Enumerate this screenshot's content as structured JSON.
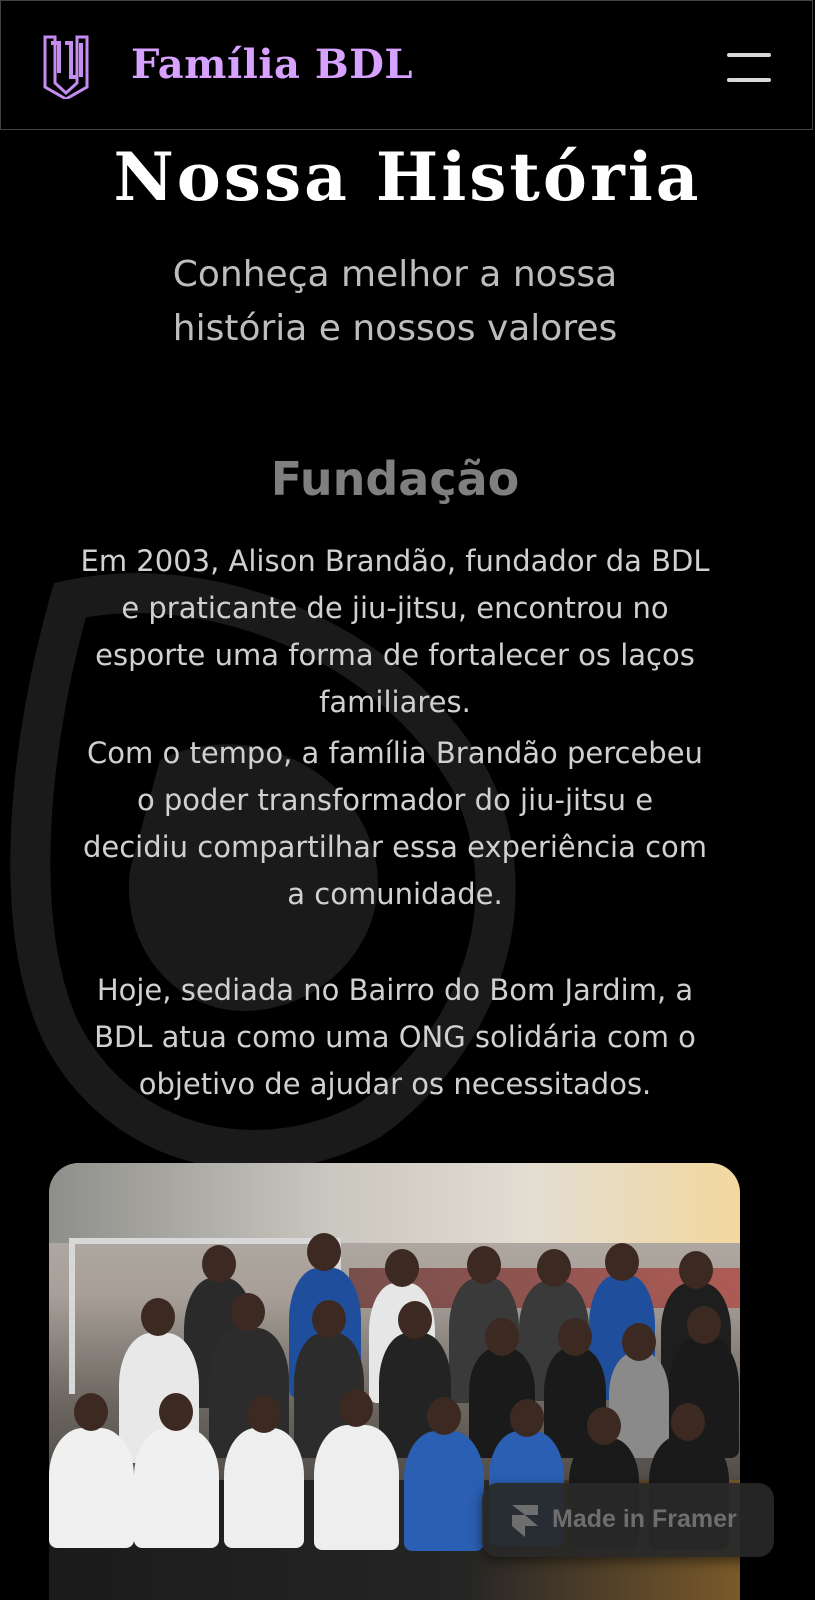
{
  "header": {
    "logo_text": "BDL",
    "brand": "Família BDL",
    "menu_icon": "hamburger-menu-icon"
  },
  "hero": {
    "title": "Nossa História",
    "subtitle": "Conheça melhor a nossa história e nossos valores"
  },
  "section": {
    "title": "Fundação",
    "paragraphs": [
      "Em 2003, Alison Brandão, fundador da BDL e praticante de jiu-jitsu, encontrou no esporte uma forma de fortalecer os laços familiares.",
      "Com o tempo, a família Brandão percebeu o poder transformador do jiu-jitsu e decidiu compartilhar essa experiência com a comunidade.",
      "Hoje, sediada no Bairro do Bom Jardim, a BDL atua como uma ONG solidária com o objetivo de ajudar os necessitados."
    ]
  },
  "badge": {
    "label": "Made in Framer",
    "icon": "framer-icon"
  },
  "colors": {
    "brand": "#d7a2ff",
    "background": "#000000",
    "section_title": "#7f7f7f"
  }
}
